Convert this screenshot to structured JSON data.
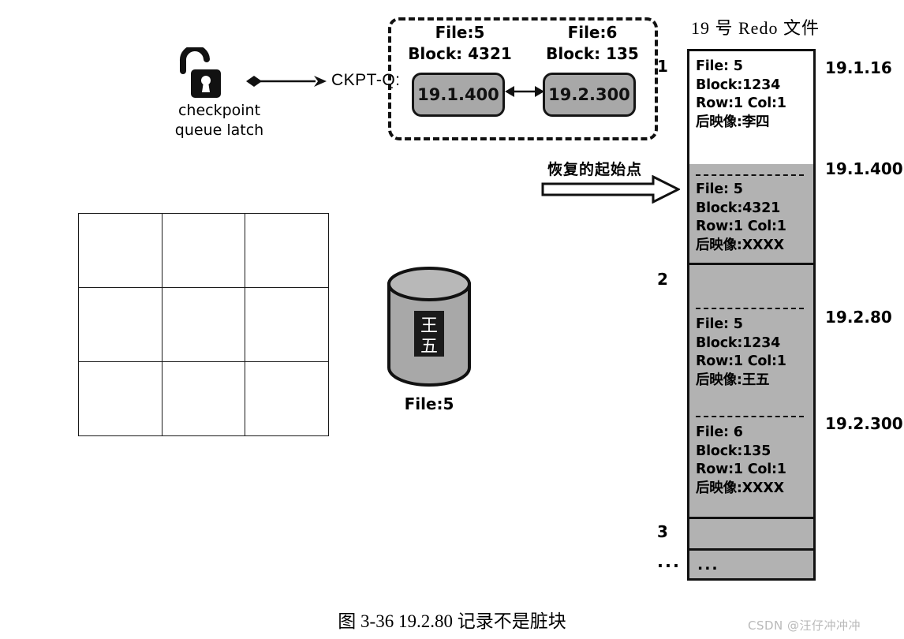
{
  "figure": {
    "caption": "图 3-36    19.2.80 记录不是脏块",
    "watermark": "CSDN @汪仔冲冲冲"
  },
  "latch": {
    "icon": "open-padlock-icon",
    "caption_line1": "checkpoint",
    "caption_line2": "queue latch",
    "connector_label": "CKPT-Q:"
  },
  "checkpoint_queue": {
    "marker": "1",
    "nodes": [
      {
        "file_label": "File:5",
        "block_label": "Block: 4321",
        "value": "19.1.400"
      },
      {
        "file_label": "File:6",
        "block_label": "Block: 135",
        "value": "19.2.300"
      }
    ]
  },
  "recovery": {
    "label": "恢复的起始点",
    "arrow": "block-arrow-right-icon"
  },
  "datafile": {
    "row_value_line1": "王",
    "row_value_line2": "五",
    "label": "File:5"
  },
  "grid": {
    "rows": 3,
    "cols": 3,
    "cells": [
      [
        "",
        "",
        ""
      ],
      [
        "",
        "",
        ""
      ],
      [
        "",
        "",
        ""
      ]
    ]
  },
  "redo": {
    "title": "19 号 Redo 文件",
    "markers": {
      "m1": "1",
      "m2": "2",
      "m3": "3",
      "m4": "..."
    },
    "entries": [
      {
        "address": "19.1.16",
        "file": "File:  5",
        "block": "Block:1234",
        "rowcol": "Row:1  Col:1",
        "after_image": "后映像:李四",
        "shaded": false
      },
      {
        "address": "19.1.400",
        "file": "File:  5",
        "block": "Block:4321",
        "rowcol": "Row:1  Col:1",
        "after_image": "后映像:XXXX",
        "shaded": true
      },
      {
        "address": "19.2.80",
        "file": "File:  5",
        "block": "Block:1234",
        "rowcol": "Row:1  Col:1",
        "after_image": "后映像:王五",
        "shaded": true
      },
      {
        "address": "19.2.300",
        "file": "File:  6",
        "block": "Block:135",
        "rowcol": "Row:1  Col:1",
        "after_image": "后映像:XXXX",
        "shaded": true
      }
    ],
    "tail_ellipsis": "..."
  },
  "colors": {
    "shade_gray": "#b2b2b2",
    "node_gray": "#a8a8a8",
    "stroke": "#111111",
    "watermark_gray": "#b9b9b9"
  }
}
